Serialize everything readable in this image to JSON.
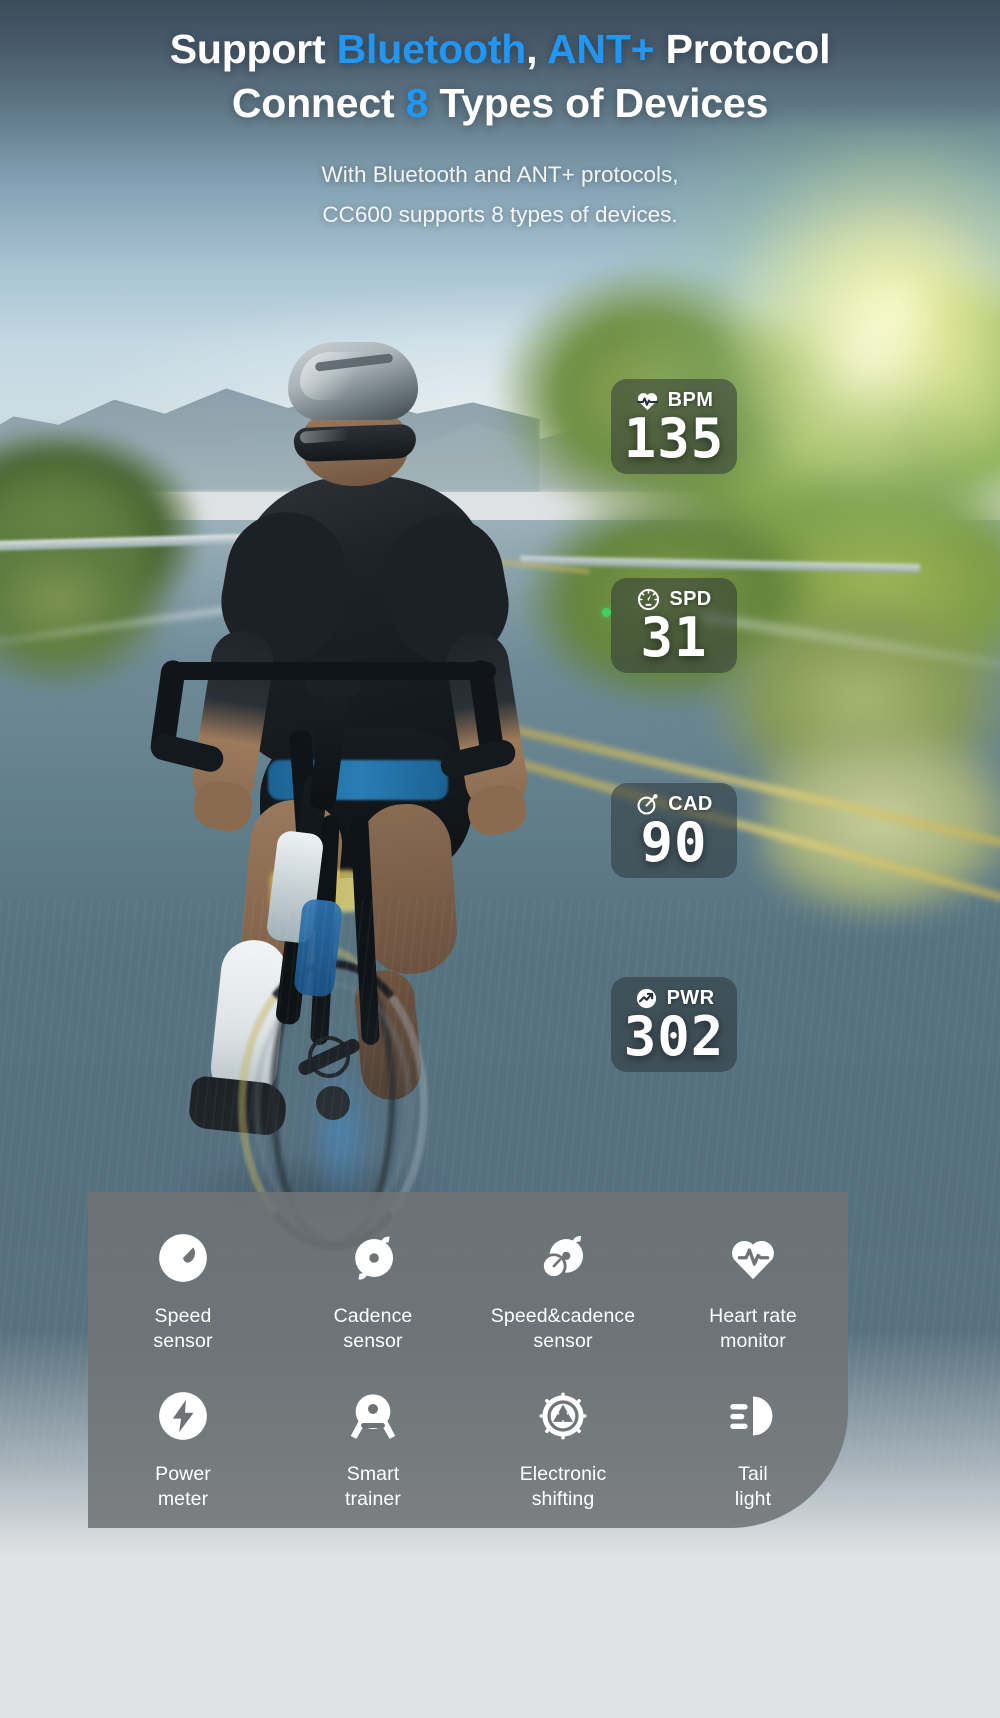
{
  "header": {
    "title_line1_part1": "Support ",
    "title_line1_accent1": "Bluetooth",
    "title_line1_part2": ", ",
    "title_line1_accent2": "ANT+",
    "title_line1_part3": " Protocol",
    "title_line2_part1": "Connect ",
    "title_line2_accent": "8",
    "title_line2_part2": " Types of Devices",
    "subtitle_line1": "With Bluetooth and ANT+ protocols,",
    "subtitle_line2": "CC600 supports 8 types of devices.",
    "accent_color": "#2196f3",
    "text_color": "#ffffff"
  },
  "hud": {
    "widgets": [
      {
        "id": "bpm",
        "icon": "heart-rate-icon",
        "label": "BPM",
        "value": "135",
        "has_status_dot": false,
        "status_dot_color": "#3fd25e"
      },
      {
        "id": "spd",
        "icon": "speedometer-icon",
        "label": "SPD",
        "value": "31",
        "has_status_dot": true,
        "status_dot_color": "#3fd25e"
      },
      {
        "id": "cad",
        "icon": "crank-cadence-icon",
        "label": "CAD",
        "value": "90",
        "has_status_dot": false,
        "status_dot_color": "#3fd25e"
      },
      {
        "id": "pwr",
        "icon": "power-bolt-circle-icon",
        "label": "PWR",
        "value": "302",
        "has_status_dot": false,
        "status_dot_color": "#3fd25e"
      }
    ],
    "card_background": "#2a3135"
  },
  "panel": {
    "background_color": "#707375",
    "rows": [
      [
        {
          "icon": "speed-sensor-icon",
          "line1": "Speed",
          "line2": "sensor"
        },
        {
          "icon": "cadence-sensor-icon",
          "line1": "Cadence",
          "line2": "sensor"
        },
        {
          "icon": "speed-cadence-sensor-icon",
          "line1": "Speed&cadence",
          "line2": "sensor"
        },
        {
          "icon": "heart-rate-monitor-icon",
          "line1": "Heart rate",
          "line2": "monitor"
        }
      ],
      [
        {
          "icon": "power-meter-icon",
          "line1": "Power",
          "line2": "meter"
        },
        {
          "icon": "smart-trainer-icon",
          "line1": "Smart",
          "line2": "trainer"
        },
        {
          "icon": "electronic-shifting-icon",
          "line1": "Electronic",
          "line2": "shifting"
        },
        {
          "icon": "tail-light-icon",
          "line1": "Tail",
          "line2": "light"
        }
      ]
    ]
  }
}
